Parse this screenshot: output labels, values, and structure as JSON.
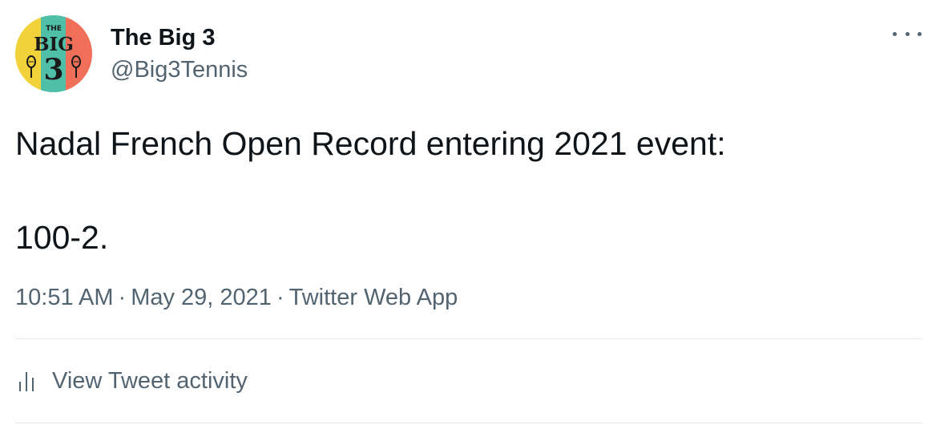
{
  "author": {
    "display_name": "The Big 3",
    "handle": "@Big3Tennis",
    "avatar_text_top": "THE",
    "avatar_text_mid": "BIG",
    "avatar_text_num": "3"
  },
  "tweet": {
    "line1": "Nadal French Open Record entering 2021 event:",
    "line2": "100-2."
  },
  "meta": {
    "time": "10:51 AM",
    "separator": "·",
    "date": "May 29, 2021",
    "source": "Twitter Web App"
  },
  "activity": {
    "label": "View Tweet activity"
  },
  "colors": {
    "text": "#0f1419",
    "secondary": "#536471",
    "divider": "#e3e7ea",
    "avatar_yellow": "#f2d23a",
    "avatar_teal": "#4fbfa8",
    "avatar_coral": "#f06f58"
  },
  "icons": {
    "more": "more-dots-icon",
    "activity": "bar-chart-icon",
    "racket": "tennis-racket-icon"
  }
}
